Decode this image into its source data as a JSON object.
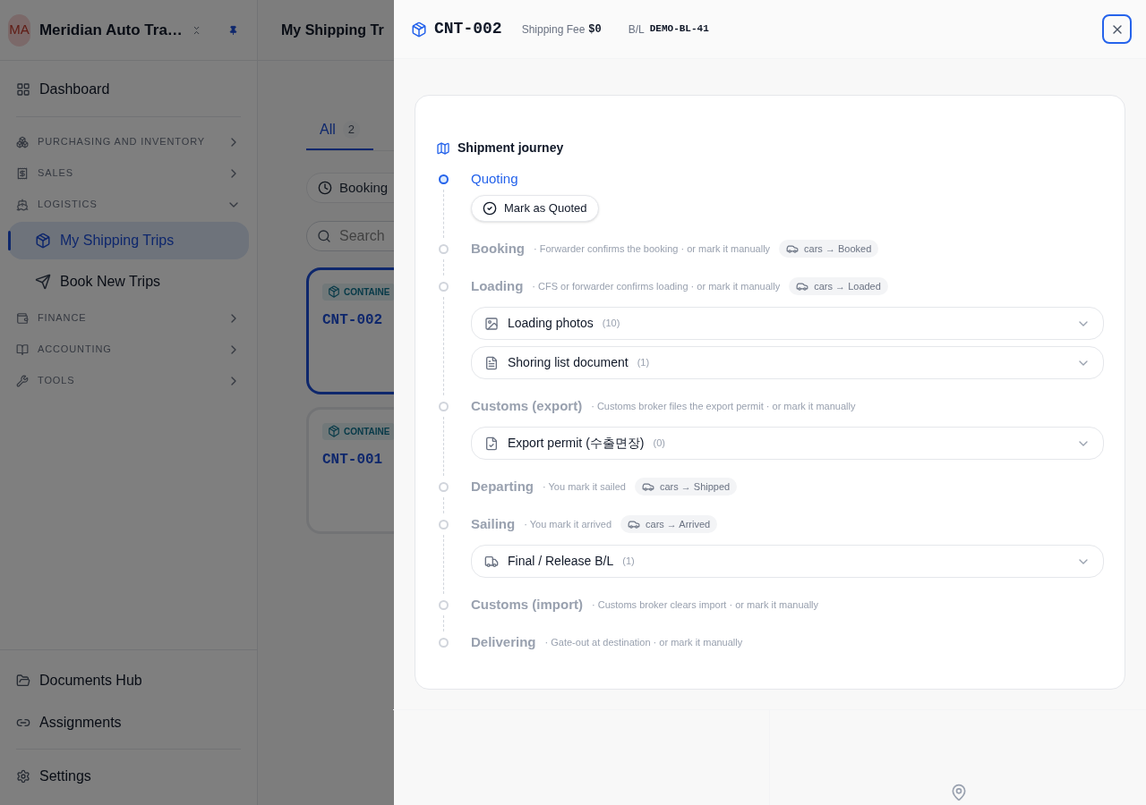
{
  "sidebar": {
    "initials": "MA",
    "workspace": "Meridian Auto Tra…",
    "items": [
      {
        "kind": "link",
        "label": "Dashboard",
        "selected": false
      },
      {
        "kind": "section",
        "label": "PURCHASING AND INVENTORY",
        "expanded": false
      },
      {
        "kind": "section",
        "label": "SALES",
        "expanded": false
      },
      {
        "kind": "section",
        "label": "LOGISTICS",
        "expanded": true,
        "children": [
          {
            "label": "My Shipping Trips",
            "selected": true
          },
          {
            "label": "Book New Trips",
            "selected": false
          }
        ]
      },
      {
        "kind": "section",
        "label": "FINANCE",
        "expanded": false
      },
      {
        "kind": "section",
        "label": "ACCOUNTING",
        "expanded": false
      },
      {
        "kind": "section",
        "label": "TOOLS",
        "expanded": false
      }
    ],
    "footer_items": [
      "Documents Hub",
      "Assignments"
    ],
    "settings": "Settings"
  },
  "main": {
    "title": "My Shipping Tr",
    "tabs": [
      {
        "label": "All",
        "count": "2",
        "selected": true
      }
    ],
    "filter_chip": "Booking",
    "search": {
      "placeholder": "Search"
    },
    "cards": [
      {
        "badge": "CONTAINE",
        "code": "CNT-002",
        "selected": true
      },
      {
        "badge": "CONTAINE",
        "code": "CNT-001",
        "selected": false
      }
    ]
  },
  "drawer": {
    "code": "CNT-002",
    "fee_label": "Shipping Fee",
    "fee": "$0",
    "bl_label": "B/L",
    "bl": "DEMO-BL-41",
    "journey": {
      "title": "Shipment journey",
      "steps": [
        {
          "name": "Quoting",
          "current": true,
          "action": "Mark as Quoted"
        },
        {
          "name": "Booking",
          "current": false,
          "note": "· Forwarder confirms the booking · or mark it manually",
          "tag": "cars → Booked"
        },
        {
          "name": "Loading",
          "current": false,
          "note": "· CFS or forwarder confirms loading · or mark it manually",
          "tag": "cars → Loaded",
          "docs": [
            {
              "kind": "photos",
              "title": "Loading photos",
              "count": "(10)"
            },
            {
              "kind": "document",
              "title": "Shoring list document",
              "count": "(1)"
            }
          ]
        },
        {
          "name": "Customs (export)",
          "current": false,
          "note": "· Customs broker files the export permit · or mark it manually",
          "docs": [
            {
              "kind": "permit",
              "title": "Export permit (수출면장)",
              "count": "(0)"
            }
          ]
        },
        {
          "name": "Departing",
          "current": false,
          "note": "· You mark it sailed",
          "tag": "cars → Shipped"
        },
        {
          "name": "Sailing",
          "current": false,
          "note": "· You mark it arrived",
          "tag": "cars → Arrived",
          "docs": [
            {
              "kind": "bl",
              "title": "Final / Release B/L",
              "count": "(1)"
            }
          ]
        },
        {
          "name": "Customs (import)",
          "current": false,
          "note": "· Customs broker clears import · or mark it manually"
        },
        {
          "name": "Delivering",
          "current": false,
          "note": "· Gate-out at destination · or mark it manually"
        }
      ]
    }
  }
}
